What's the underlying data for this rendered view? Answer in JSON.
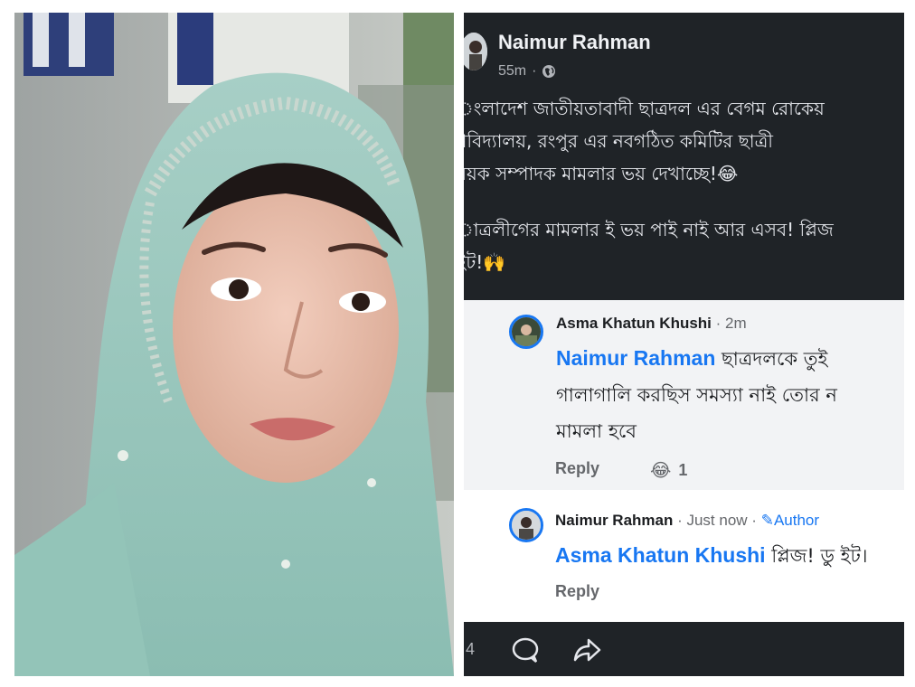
{
  "post": {
    "author": "Naimur Rahman",
    "time": "55m",
    "visibility_icon": "globe-icon",
    "text_lines_1": [
      "ংলাদেশ জাতীয়তাবাদী ছাত্রদল এর বেগম রোকেয়",
      "শ্ববিদ্যালয়, রংপুর এর নবগঠিত কমিটির ছাত্রী",
      "ষয়ক সম্পাদক মামলার ভয় দেখাচ্ছে!😂"
    ],
    "text_lines_2": [
      "াত্রলীগের মামলার ই ভয় পাই নাই আর এসব! প্লিজ",
      "ইট!🙌"
    ]
  },
  "comments": [
    {
      "author": "Asma Khatun Khushi",
      "time": "· 2m",
      "mention": "Naimur Rahman",
      "text_line1": " ছাত্রদলকে তুই",
      "text_line2": "গালাগালি করছিস সমস্যা নাই তোর ন",
      "text_line3": "মামলা হবে",
      "reply_label": "Reply",
      "reaction_emoji": "😂",
      "reaction_count": "1"
    },
    {
      "author": "Naimur Rahman",
      "time": " · Just now · ",
      "author_badge": "Author",
      "mention": "Asma Khatun Khushi",
      "text": " প্লিজ! ডু ইট।",
      "reply_label": "Reply"
    }
  ],
  "footer": {
    "count": "4",
    "comment_icon": "comment-icon",
    "share_icon": "share-icon"
  },
  "colors": {
    "fb_dark": "#1f2327",
    "fb_blue": "#1877f2",
    "comment_bg": "#f2f3f5"
  }
}
